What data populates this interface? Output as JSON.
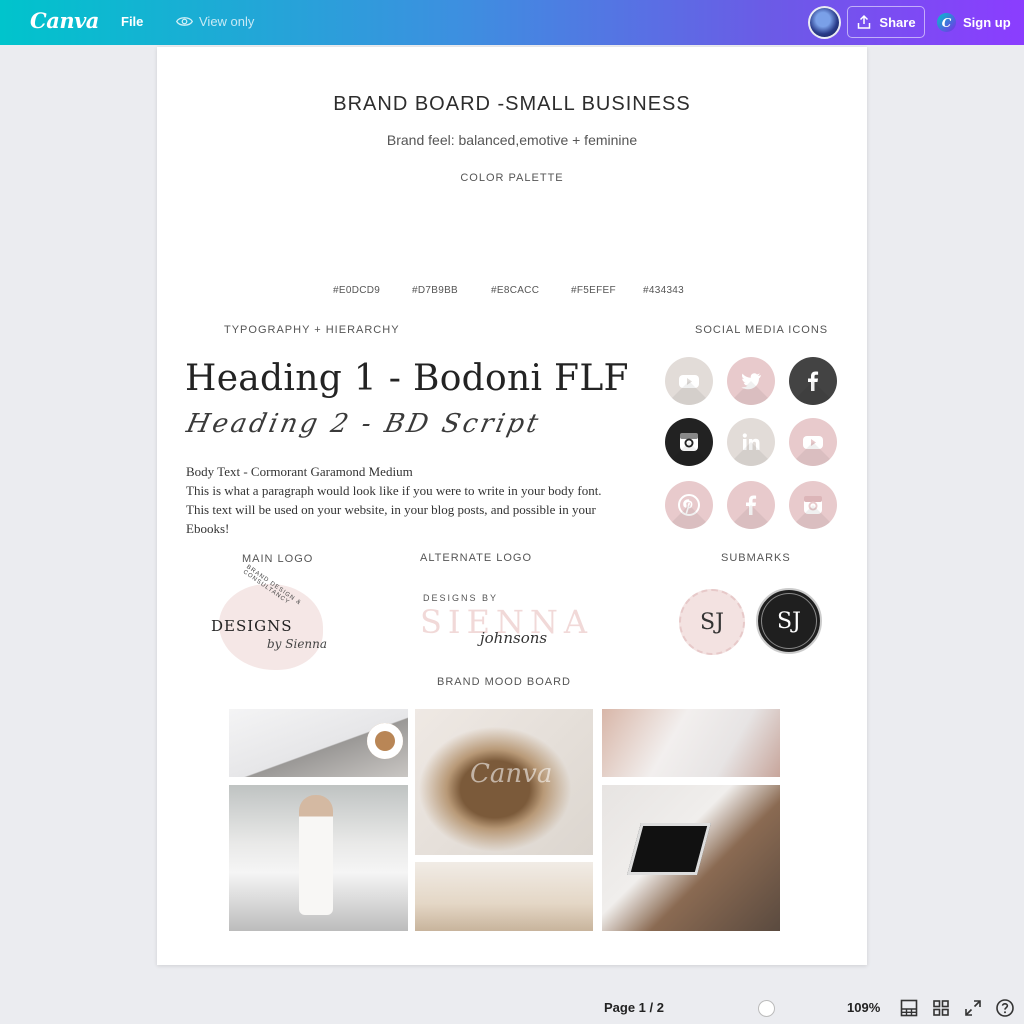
{
  "topbar": {
    "logo": "Canva",
    "file_label": "File",
    "view_only_label": "View only",
    "share_label": "Share",
    "signup_label": "Sign up"
  },
  "page": {
    "title": "BRAND BOARD -SMALL BUSINESS",
    "subtitle": "Brand feel: balanced,emotive + feminine",
    "color_palette_label": "COLOR PALETTE",
    "colors": [
      "#E0DCD9",
      "#D7B9BB",
      "#E8CACC",
      "#F5EFEF",
      "#434343"
    ],
    "typography_label": "TYPOGRAPHY + HIERARCHY",
    "heading1": "Heading 1 - Bodoni FLF",
    "heading2": "Heading 2 - BD Script",
    "body_title": "Body Text - Cormorant Garamond Medium",
    "body_text": "This is what a paragraph would look like if you were to write in your body font. This text will be used on your website, in your blog posts, and possible in your Ebooks!",
    "social_label": "SOCIAL MEDIA ICONS",
    "social_icons": [
      "youtube-icon",
      "twitter-icon",
      "facebook-icon",
      "instagram-icon",
      "linkedin-icon",
      "youtube-icon",
      "pinterest-icon",
      "facebook-icon",
      "instagram-icon"
    ],
    "main_logo_label": "MAIN LOGO",
    "alt_logo_label": "ALTERNATE LOGO",
    "submarks_label": "SUBMARKS",
    "main_logo": {
      "word": "DESIGNS",
      "script": "by Sienna",
      "arc": "BRAND DESIGN & CONSULTANCY"
    },
    "alt_logo": {
      "top": "DESIGNS BY",
      "name": "SIENNA",
      "script": "johnsons"
    },
    "submark_text": "SJ",
    "mood_board_label": "BRAND MOOD BOARD",
    "watermark": "Canva"
  },
  "bottombar": {
    "page_indicator": "Page 1 / 2",
    "zoom": "109%"
  }
}
